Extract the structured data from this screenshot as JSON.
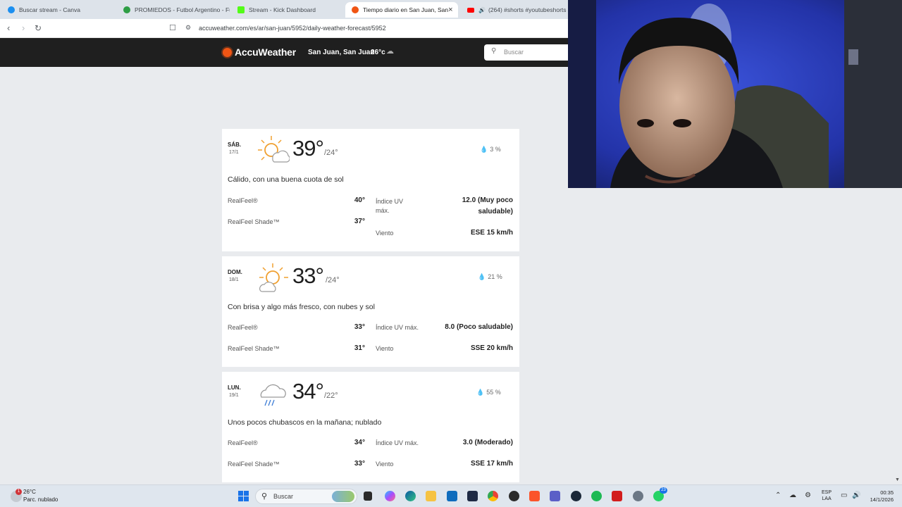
{
  "browser": {
    "tabs": [
      {
        "label": "Buscar stream - Canva",
        "favicon_color": "#1b8ff0"
      },
      {
        "label": "PROMIEDOS - Futbol Argentino - Fu",
        "favicon_color": "#2e9e45"
      },
      {
        "label": "Stream - Kick Dashboard",
        "favicon_color": "#53fc18"
      },
      {
        "label": "Tiempo diario en San Juan, San",
        "favicon_color": "#f05514"
      },
      {
        "label": "(264) #shorts #youtubeshorts #s",
        "favicon_color": "#ff0000"
      }
    ],
    "active_tab": 3,
    "close_glyph": "×",
    "url": "accuweather.com/es/ar/san-juan/5952/daily-weather-forecast/5952"
  },
  "site": {
    "brand": "AccuWeather",
    "location": "San Juan, San Juan",
    "current_temp": "26°c",
    "search_placeholder": "Buscar",
    "accent": "#f05514"
  },
  "forecast": [
    {
      "day": "SÁB.",
      "date": "17/1",
      "icon": "partly-sunny-icon",
      "high": "39°",
      "low": "/24°",
      "precip": "3 %",
      "phrase": "Cálido, con una buena cuota de sol",
      "realfeel_label": "RealFeel®",
      "realfeel": "40°",
      "realfeel_shade_label": "RealFeel Shade™",
      "realfeel_shade": "37°",
      "uv_label_1": "Índice UV",
      "uv_label_2": "máx.",
      "uv_value_1": "12.0 (Muy poco",
      "uv_value_2": "saludable)",
      "wind_label": "Viento",
      "wind": "ESE 15 km/h"
    },
    {
      "day": "DOM.",
      "date": "18/1",
      "icon": "partly-sunny-icon",
      "high": "33°",
      "low": "/24°",
      "precip": "21 %",
      "phrase": "Con brisa y algo más fresco, con nubes y sol",
      "realfeel_label": "RealFeel®",
      "realfeel": "33°",
      "realfeel_shade_label": "RealFeel Shade™",
      "realfeel_shade": "31°",
      "uv_label": "Índice UV máx.",
      "uv_value": "8.0 (Poco saludable)",
      "wind_label": "Viento",
      "wind": "SSE 20 km/h"
    },
    {
      "day": "LUN.",
      "date": "19/1",
      "icon": "rain-showers-icon",
      "high": "34°",
      "low": "/22°",
      "precip": "55 %",
      "phrase": "Unos pocos chubascos en la mañana; nublado",
      "realfeel_label": "RealFeel®",
      "realfeel": "34°",
      "realfeel_shade_label": "RealFeel Shade™",
      "realfeel_shade": "33°",
      "uv_label": "Índice UV máx.",
      "uv_value": "3.0 (Moderado)",
      "wind_label": "Viento",
      "wind": "SSE 17 km/h"
    }
  ],
  "taskbar": {
    "weather_temp": "26°C",
    "weather_desc": "Parc. nublado",
    "notification_count": "1",
    "search_placeholder": "Buscar",
    "whatsapp_badge": "23",
    "lang_1": "ESP",
    "lang_2": "LAA",
    "time": "00:35",
    "date": "14/1/2026"
  }
}
